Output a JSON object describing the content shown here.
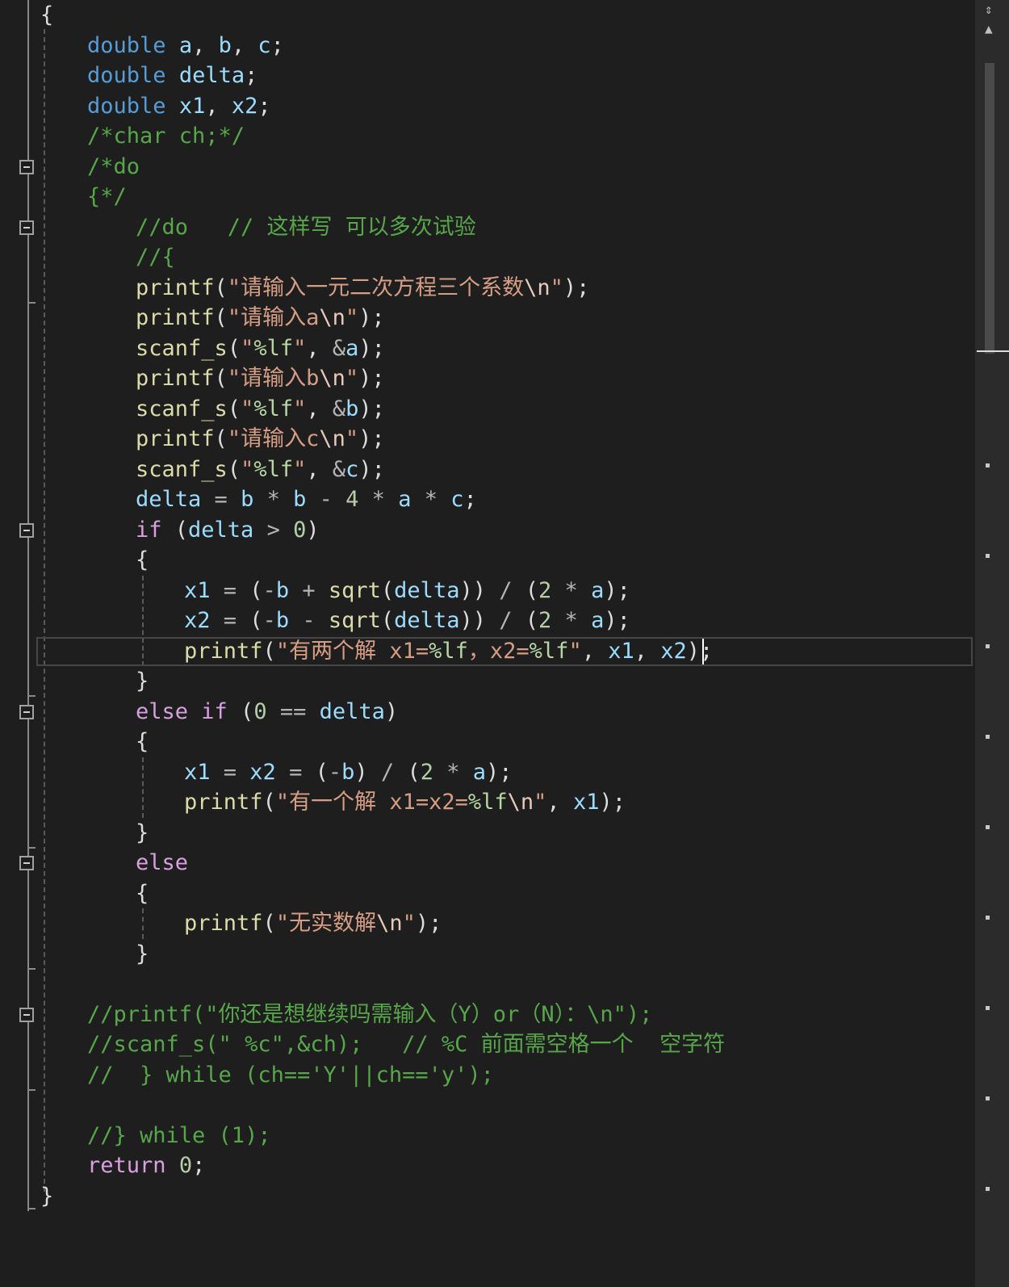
{
  "editor": {
    "lines": [
      [
        [
          "pun",
          "{"
        ]
      ],
      [
        [
          "kw",
          "double"
        ],
        [
          "pun",
          " "
        ],
        [
          "var",
          "a"
        ],
        [
          "pun",
          ", "
        ],
        [
          "var",
          "b"
        ],
        [
          "pun",
          ", "
        ],
        [
          "var",
          "c"
        ],
        [
          "pun",
          ";"
        ]
      ],
      [
        [
          "kw",
          "double"
        ],
        [
          "pun",
          " "
        ],
        [
          "var",
          "delta"
        ],
        [
          "pun",
          ";"
        ]
      ],
      [
        [
          "kw",
          "double"
        ],
        [
          "pun",
          " "
        ],
        [
          "var",
          "x1"
        ],
        [
          "pun",
          ", "
        ],
        [
          "var",
          "x2"
        ],
        [
          "pun",
          ";"
        ]
      ],
      [
        [
          "cmt",
          "/*char ch;*/"
        ]
      ],
      [
        [
          "cmt",
          "/*do"
        ]
      ],
      [
        [
          "cmt",
          "{*/"
        ]
      ],
      [
        [
          "cmt",
          "//do   // 这样写 可以多次试验"
        ]
      ],
      [
        [
          "cmt",
          "//{"
        ]
      ],
      [
        [
          "fn",
          "printf"
        ],
        [
          "pun",
          "("
        ],
        [
          "str",
          "\"请输入一元二次方程三个系数"
        ],
        [
          "esc",
          "\\n"
        ],
        [
          "str",
          "\""
        ],
        [
          "pun",
          ");"
        ]
      ],
      [
        [
          "fn",
          "printf"
        ],
        [
          "pun",
          "("
        ],
        [
          "str",
          "\"请输入a"
        ],
        [
          "esc",
          "\\n"
        ],
        [
          "str",
          "\""
        ],
        [
          "pun",
          ");"
        ]
      ],
      [
        [
          "fn",
          "scanf_s"
        ],
        [
          "pun",
          "("
        ],
        [
          "str",
          "\""
        ],
        [
          "fmt",
          "%lf"
        ],
        [
          "str",
          "\""
        ],
        [
          "pun",
          ", "
        ],
        [
          "op",
          "&"
        ],
        [
          "var",
          "a"
        ],
        [
          "pun",
          ");"
        ]
      ],
      [
        [
          "fn",
          "printf"
        ],
        [
          "pun",
          "("
        ],
        [
          "str",
          "\"请输入b"
        ],
        [
          "esc",
          "\\n"
        ],
        [
          "str",
          "\""
        ],
        [
          "pun",
          ");"
        ]
      ],
      [
        [
          "fn",
          "scanf_s"
        ],
        [
          "pun",
          "("
        ],
        [
          "str",
          "\""
        ],
        [
          "fmt",
          "%lf"
        ],
        [
          "str",
          "\""
        ],
        [
          "pun",
          ", "
        ],
        [
          "op",
          "&"
        ],
        [
          "var",
          "b"
        ],
        [
          "pun",
          ");"
        ]
      ],
      [
        [
          "fn",
          "printf"
        ],
        [
          "pun",
          "("
        ],
        [
          "str",
          "\"请输入c"
        ],
        [
          "esc",
          "\\n"
        ],
        [
          "str",
          "\""
        ],
        [
          "pun",
          ");"
        ]
      ],
      [
        [
          "fn",
          "scanf_s"
        ],
        [
          "pun",
          "("
        ],
        [
          "str",
          "\""
        ],
        [
          "fmt",
          "%lf"
        ],
        [
          "str",
          "\""
        ],
        [
          "pun",
          ", "
        ],
        [
          "op",
          "&"
        ],
        [
          "var",
          "c"
        ],
        [
          "pun",
          ");"
        ]
      ],
      [
        [
          "var",
          "delta"
        ],
        [
          "op",
          " = "
        ],
        [
          "var",
          "b"
        ],
        [
          "op",
          " * "
        ],
        [
          "var",
          "b"
        ],
        [
          "op",
          " - "
        ],
        [
          "num",
          "4"
        ],
        [
          "op",
          " * "
        ],
        [
          "var",
          "a"
        ],
        [
          "op",
          " * "
        ],
        [
          "var",
          "c"
        ],
        [
          "pun",
          ";"
        ]
      ],
      [
        [
          "ctl",
          "if"
        ],
        [
          "pun",
          " ("
        ],
        [
          "var",
          "delta"
        ],
        [
          "op",
          " > "
        ],
        [
          "num",
          "0"
        ],
        [
          "pun",
          ")"
        ]
      ],
      [
        [
          "pun",
          "{"
        ]
      ],
      [
        [
          "var",
          "x1"
        ],
        [
          "op",
          " = "
        ],
        [
          "pun",
          "("
        ],
        [
          "op",
          "-"
        ],
        [
          "var",
          "b"
        ],
        [
          "op",
          " + "
        ],
        [
          "fn",
          "sqrt"
        ],
        [
          "pun",
          "("
        ],
        [
          "var",
          "delta"
        ],
        [
          "pun",
          "))"
        ],
        [
          "op",
          " / "
        ],
        [
          "pun",
          "("
        ],
        [
          "num",
          "2"
        ],
        [
          "op",
          " * "
        ],
        [
          "var",
          "a"
        ],
        [
          "pun",
          ");"
        ]
      ],
      [
        [
          "var",
          "x2"
        ],
        [
          "op",
          " = "
        ],
        [
          "pun",
          "("
        ],
        [
          "op",
          "-"
        ],
        [
          "var",
          "b"
        ],
        [
          "op",
          " - "
        ],
        [
          "fn",
          "sqrt"
        ],
        [
          "pun",
          "("
        ],
        [
          "var",
          "delta"
        ],
        [
          "pun",
          "))"
        ],
        [
          "op",
          " / "
        ],
        [
          "pun",
          "("
        ],
        [
          "num",
          "2"
        ],
        [
          "op",
          " * "
        ],
        [
          "var",
          "a"
        ],
        [
          "pun",
          ");"
        ]
      ],
      [
        [
          "fn",
          "printf"
        ],
        [
          "pun",
          "("
        ],
        [
          "str",
          "\"有两个解 x1="
        ],
        [
          "fmt",
          "%lf"
        ],
        [
          "str",
          "，x2="
        ],
        [
          "fmt",
          "%lf"
        ],
        [
          "str",
          "\""
        ],
        [
          "pun",
          ", "
        ],
        [
          "var",
          "x1"
        ],
        [
          "pun",
          ", "
        ],
        [
          "var",
          "x2"
        ],
        [
          "pun",
          ");"
        ]
      ],
      [
        [
          "pun",
          "}"
        ]
      ],
      [
        [
          "ctl",
          "else if"
        ],
        [
          "pun",
          " ("
        ],
        [
          "num",
          "0"
        ],
        [
          "op",
          " == "
        ],
        [
          "var",
          "delta"
        ],
        [
          "pun",
          ")"
        ]
      ],
      [
        [
          "pun",
          "{"
        ]
      ],
      [
        [
          "var",
          "x1"
        ],
        [
          "op",
          " = "
        ],
        [
          "var",
          "x2"
        ],
        [
          "op",
          " = "
        ],
        [
          "pun",
          "("
        ],
        [
          "op",
          "-"
        ],
        [
          "var",
          "b"
        ],
        [
          "pun",
          ")"
        ],
        [
          "op",
          " / "
        ],
        [
          "pun",
          "("
        ],
        [
          "num",
          "2"
        ],
        [
          "op",
          " * "
        ],
        [
          "var",
          "a"
        ],
        [
          "pun",
          ");"
        ]
      ],
      [
        [
          "fn",
          "printf"
        ],
        [
          "pun",
          "("
        ],
        [
          "str",
          "\"有一个解 x1=x2="
        ],
        [
          "fmt",
          "%lf"
        ],
        [
          "esc",
          "\\n"
        ],
        [
          "str",
          "\""
        ],
        [
          "pun",
          ", "
        ],
        [
          "var",
          "x1"
        ],
        [
          "pun",
          ");"
        ]
      ],
      [
        [
          "pun",
          "}"
        ]
      ],
      [
        [
          "ctl",
          "else"
        ]
      ],
      [
        [
          "pun",
          "{"
        ]
      ],
      [
        [
          "fn",
          "printf"
        ],
        [
          "pun",
          "("
        ],
        [
          "str",
          "\"无实数解"
        ],
        [
          "esc",
          "\\n"
        ],
        [
          "str",
          "\""
        ],
        [
          "pun",
          ");"
        ]
      ],
      [
        [
          "pun",
          "}"
        ]
      ],
      [],
      [
        [
          "cmt",
          "//printf(\"你还是想继续吗需输入（Y）or（N）：\\n\");"
        ]
      ],
      [
        [
          "cmt",
          "//scanf_s(\" %c\",&ch);   // %C 前面需空格一个  空字符"
        ]
      ],
      [
        [
          "cmt",
          "//  } while (ch=='Y'||ch=='y');"
        ]
      ],
      [],
      [
        [
          "cmt",
          "//} while (1);"
        ]
      ],
      [
        [
          "ctl",
          "return"
        ],
        [
          "pun",
          " "
        ],
        [
          "num",
          "0"
        ],
        [
          "pun",
          ";"
        ]
      ],
      [
        [
          "pun",
          "}"
        ]
      ]
    ]
  }
}
